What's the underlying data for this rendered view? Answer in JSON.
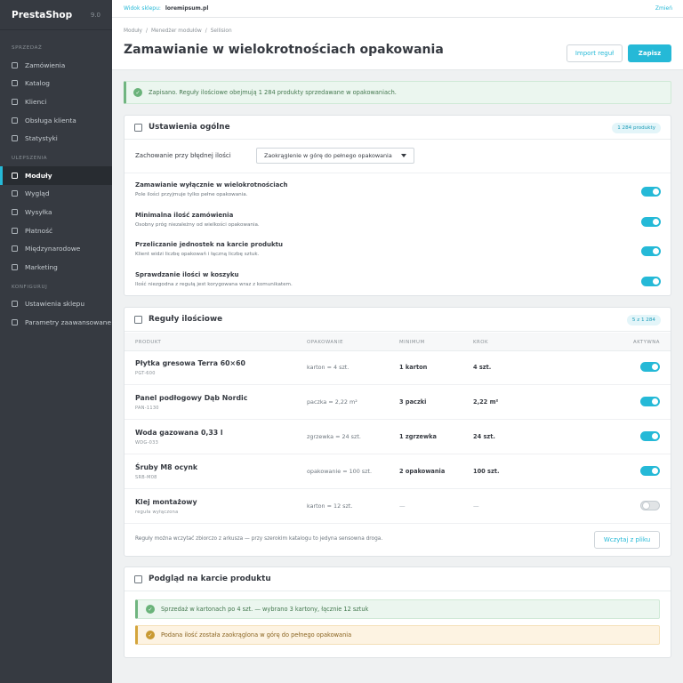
{
  "brand": {
    "name": "PrestaShop",
    "version": "9.0"
  },
  "sidebar": {
    "section_sell": "SPRZEDAŻ",
    "sell_items": [
      "Zamówienia",
      "Katalog",
      "Klienci",
      "Obsługa klienta",
      "Statystyki"
    ],
    "section_improve": "ULEPSZENIA",
    "improve_items": [
      "Moduły",
      "Wygląd",
      "Wysyłka",
      "Płatność",
      "Międzynarodowe",
      "Marketing"
    ],
    "active_item": "Moduły",
    "section_configure": "KONFIGURUJ",
    "configure_items": [
      "Ustawienia sklepu",
      "Parametry zaawansowane"
    ]
  },
  "topbar": {
    "shop_label": "Widok sklepu:",
    "shop_name": "loremipsum.pl",
    "change_label": "Zmień"
  },
  "header": {
    "breadcrumbs": [
      "Moduły",
      "/",
      "Menedżer modułów",
      "/",
      "Sellision"
    ],
    "title": "Zamawianie w wielokrotnościach opakowania",
    "import_label": "Import reguł",
    "save_label": "Zapisz"
  },
  "alert": {
    "text": "Zapisano. Reguły ilościowe obejmują 1 284 produkty sprzedawane w opakowaniach."
  },
  "general": {
    "title": "Ustawienia ogólne",
    "badge": "1 284 produkty",
    "behavior_label": "Zachowanie przy błędnej ilości",
    "behavior_value": "Zaokrąglenie w górę do pełnego opakowania",
    "options": [
      {
        "name": "Zamawianie wyłącznie w wielokrotnościach",
        "desc": "Pole ilości przyjmuje tylko pełne opakowania.",
        "enabled": true
      },
      {
        "name": "Minimalna ilość zamówienia",
        "desc": "Osobny próg niezależny od wielkości opakowania.",
        "enabled": true
      },
      {
        "name": "Przeliczanie jednostek na karcie produktu",
        "desc": "Klient widzi liczbę opakowań i łączną liczbę sztuk.",
        "enabled": true
      },
      {
        "name": "Sprawdzanie ilości w koszyku",
        "desc": "Ilość niezgodna z regułą jest korygowana wraz z komunikatem.",
        "enabled": true
      }
    ]
  },
  "rules": {
    "title": "Reguły ilościowe",
    "badge": "5 z 1 284",
    "columns": {
      "product": "PRODUKT",
      "package": "OPAKOWANIE",
      "minimum": "MINIMUM",
      "step": "KROK",
      "active": "AKTYWNA"
    },
    "rows": [
      {
        "name": "Płytka gresowa Terra 60×60",
        "sku": "PGT-600",
        "package": "karton = 4 szt.",
        "minimum": "1 karton",
        "step": "4 szt.",
        "active": true
      },
      {
        "name": "Panel podłogowy Dąb Nordic",
        "sku": "PAN-1130",
        "package": "paczka = 2,22 m²",
        "minimum": "3 paczki",
        "step": "2,22 m²",
        "active": true
      },
      {
        "name": "Woda gazowana 0,33 l",
        "sku": "WDG-033",
        "package": "zgrzewka = 24 szt.",
        "minimum": "1 zgrzewka",
        "step": "24 szt.",
        "active": true
      },
      {
        "name": "Śruby M8 ocynk",
        "sku": "SRB-M08",
        "package": "opakowanie = 100 szt.",
        "minimum": "2 opakowania",
        "step": "100 szt.",
        "active": true
      },
      {
        "name": "Klej montażowy",
        "sku": "reguła wyłączona",
        "package": "karton = 12 szt.",
        "minimum": "—",
        "step": "—",
        "active": false
      }
    ],
    "footer_note": "Reguły można wczytać zbiorczo z arkusza — przy szerokim katalogu to jedyna sensowna droga.",
    "upload_label": "Wczytaj z pliku"
  },
  "preview": {
    "title": "Podgląd na karcie produktu",
    "success_text": "Sprzedaż w kartonach po 4 szt. — wybrano 3 kartony, łącznie 12 sztuk",
    "warning_text": "Podana ilość została zaokrąglona w górę do pełnego opakowania"
  },
  "colors": {
    "accent": "#25b9d7",
    "sidebar": "#363a41",
    "success": "#70b580",
    "warning": "#d4a53c"
  }
}
